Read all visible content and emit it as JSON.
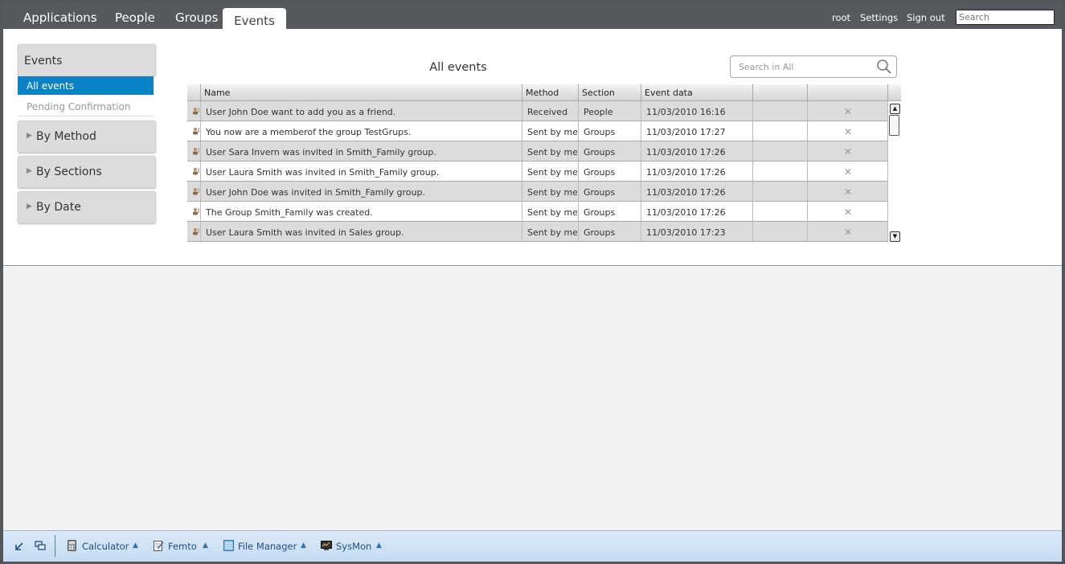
{
  "nav": {
    "tabs": [
      "Applications",
      "People",
      "Groups",
      "Events"
    ],
    "active_tab": "Events",
    "links": [
      "root",
      "Settings",
      "Sign out"
    ],
    "search_placeholder": "Search"
  },
  "sidebar": {
    "header": "Events",
    "selected": "All events",
    "pending": "Pending Confirmation",
    "groups": [
      "By Method",
      "By Sections",
      "By Date"
    ]
  },
  "list": {
    "title": "All events",
    "search_placeholder": "Search in All",
    "columns": [
      "Name",
      "Method",
      "Section",
      "Event data"
    ],
    "rows": [
      {
        "name": "User John Doe want to add you as a friend.",
        "method": "Received",
        "section": "People",
        "date": "11/03/2010 16:16"
      },
      {
        "name": "You now are a memberof the group TestGrups.",
        "method": "Sent by me",
        "section": "Groups",
        "date": "11/03/2010 17:27"
      },
      {
        "name": "User Sara Invern was invited in Smith_Family group.",
        "method": "Sent by me",
        "section": "Groups",
        "date": "11/03/2010 17:26"
      },
      {
        "name": "User Laura Smith was invited in Smith_Family group.",
        "method": "Sent by me",
        "section": "Groups",
        "date": "11/03/2010 17:26"
      },
      {
        "name": "User John Doe was invited in Smith_Family group.",
        "method": "Sent by me",
        "section": "Groups",
        "date": "11/03/2010 17:26"
      },
      {
        "name": "The Group Smith_Family was created.",
        "method": "Sent by me",
        "section": "Groups",
        "date": "11/03/2010 17:26"
      },
      {
        "name": "User Laura Smith was invited in Sales group.",
        "method": "Sent by me",
        "section": "Groups",
        "date": "11/03/2010 17:23"
      }
    ]
  },
  "taskbar": {
    "apps": [
      "Calculator",
      "Femto",
      "File Manager",
      "SysMon"
    ]
  },
  "colors": {
    "accent": "#0a82c8",
    "chrome": "#565a5f",
    "taskbar": "#d2e4f6"
  }
}
